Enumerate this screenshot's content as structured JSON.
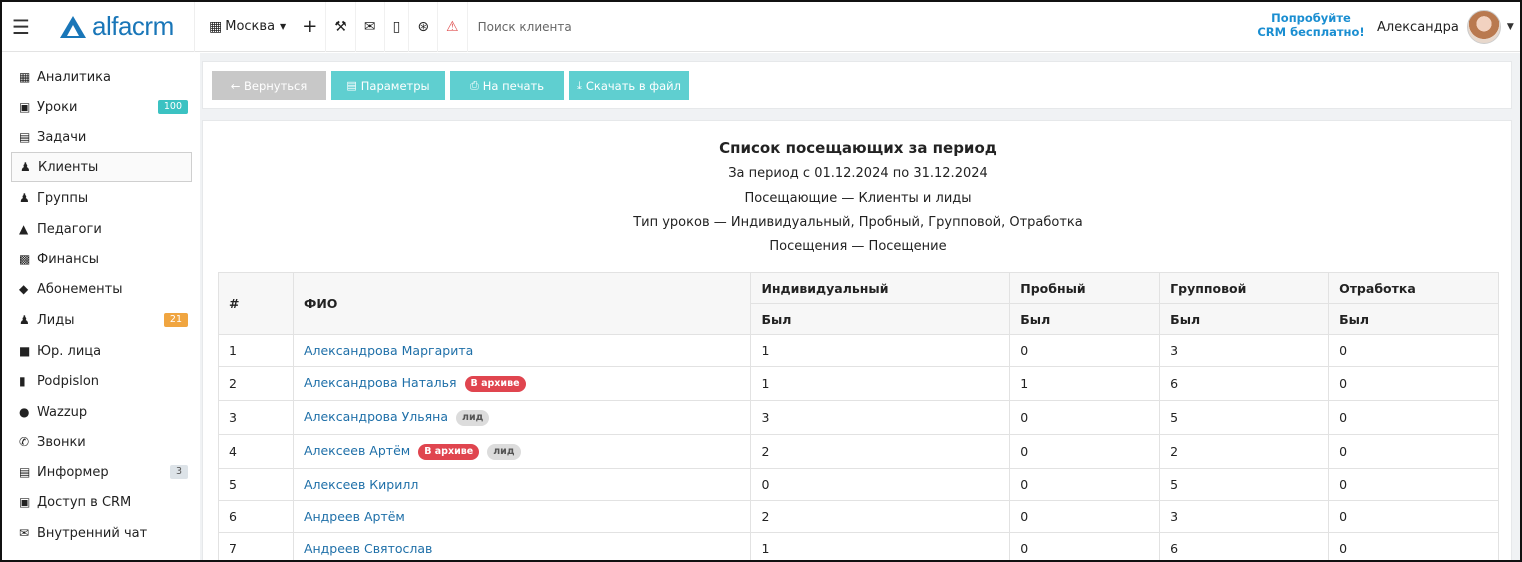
{
  "topbar": {
    "logo_text": "alfacrm",
    "city": "Москва",
    "search_placeholder": "Поиск клиента",
    "try_line1": "Попробуйте",
    "try_line2": "CRM бесплатно!",
    "user_name": "Александра",
    "icons": [
      "plus-icon",
      "wrench-icon",
      "envelope-icon",
      "mobile-icon",
      "cart-icon",
      "bell-icon"
    ]
  },
  "sidebar": {
    "items": [
      {
        "label": "Аналитика",
        "icon": "map-icon"
      },
      {
        "label": "Уроки",
        "icon": "calendar-icon",
        "badge": "100"
      },
      {
        "label": "Задачи",
        "icon": "clipboard-icon"
      },
      {
        "label": "Клиенты",
        "icon": "user-icon",
        "active": true
      },
      {
        "label": "Группы",
        "icon": "users-icon"
      },
      {
        "label": "Педагоги",
        "icon": "graduation-cap-icon"
      },
      {
        "label": "Финансы",
        "icon": "money-icon"
      },
      {
        "label": "Абонементы",
        "icon": "tag-icon"
      },
      {
        "label": "Лиды",
        "icon": "user-plus-icon",
        "badge": "21"
      },
      {
        "label": "Юр. лица",
        "icon": "briefcase-icon"
      },
      {
        "label": "Podpislon",
        "icon": "file-icon"
      },
      {
        "label": "Wazzup",
        "icon": "whatsapp-icon"
      },
      {
        "label": "Звонки",
        "icon": "phone-icon"
      },
      {
        "label": "Информер",
        "icon": "list-icon",
        "badge": "3"
      },
      {
        "label": "Доступ в CRM",
        "icon": "lock-icon"
      },
      {
        "label": "Внутренний чат",
        "icon": "envelope-icon"
      }
    ]
  },
  "toolbar": {
    "back_label": "← Вернуться",
    "params_label": "Параметры",
    "print_label": "На печать",
    "download_label": "Скачать в файл"
  },
  "report": {
    "title": "Список посещающих за период",
    "period": "За период с 01.12.2024 по 31.12.2024",
    "visitors": "Посещающие — Клиенты и лиды",
    "lesson_types": "Тип уроков — Индивидуальный, Пробный, Групповой, Отработка",
    "visits": "Посещения — Посещение",
    "columns": {
      "num": "#",
      "name": "ФИО",
      "individual": "Индивидуальный",
      "trial": "Пробный",
      "group": "Групповой",
      "makeup": "Отработка",
      "sub": "Был"
    },
    "tag_archive": "В архиве",
    "tag_lead": "лид",
    "rows": [
      {
        "num": "1",
        "name": "Александрова Маргарита",
        "individual": "1",
        "trial": "0",
        "group": "3",
        "makeup": "0",
        "archive": false,
        "lead": false
      },
      {
        "num": "2",
        "name": "Александрова Наталья",
        "individual": "1",
        "trial": "1",
        "group": "6",
        "makeup": "0",
        "archive": true,
        "lead": false
      },
      {
        "num": "3",
        "name": "Александрова Ульяна",
        "individual": "3",
        "trial": "0",
        "group": "5",
        "makeup": "0",
        "archive": false,
        "lead": true
      },
      {
        "num": "4",
        "name": "Алексеев Артём",
        "individual": "2",
        "trial": "0",
        "group": "2",
        "makeup": "0",
        "archive": true,
        "lead": true
      },
      {
        "num": "5",
        "name": "Алексеев Кирилл",
        "individual": "0",
        "trial": "0",
        "group": "5",
        "makeup": "0",
        "archive": false,
        "lead": false
      },
      {
        "num": "6",
        "name": "Андреев Артём",
        "individual": "2",
        "trial": "0",
        "group": "3",
        "makeup": "0",
        "archive": false,
        "lead": false
      },
      {
        "num": "7",
        "name": "Андреев Святослав",
        "individual": "1",
        "trial": "0",
        "group": "6",
        "makeup": "0",
        "archive": false,
        "lead": false
      }
    ]
  },
  "colors": {
    "brand": "#1976b8",
    "accent_button": "#5fcfd0",
    "disabled_button": "#c8c8c8",
    "archive_tag": "#e0454f",
    "link": "#1e6fa8"
  }
}
